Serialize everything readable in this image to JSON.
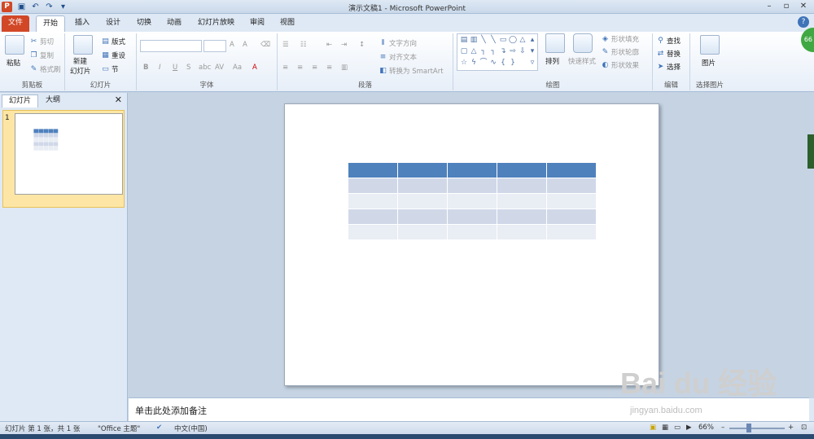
{
  "window": {
    "title": "演示文稿1 - Microsoft PowerPoint",
    "app_badge": "P"
  },
  "tabs": [
    "文件",
    "开始",
    "插入",
    "设计",
    "切换",
    "动画",
    "幻灯片放映",
    "审阅",
    "视图"
  ],
  "ribbon": {
    "clipboard": {
      "paste": "粘贴",
      "cut": "剪切",
      "copy": "复制",
      "format_painter": "格式刷",
      "label": "剪贴板"
    },
    "slides": {
      "new_slide": "新建",
      "new_slide2": "幻灯片",
      "layout": "版式",
      "reset": "重设",
      "section": "节",
      "label": "幻灯片"
    },
    "font": {
      "grow": "A",
      "shrink": "A",
      "bold": "B",
      "italic": "I",
      "underline": "U",
      "strike": "S",
      "shadow": "abc",
      "spacing": "AV",
      "case": "Aa",
      "label": "字体"
    },
    "paragraph": {
      "text_direction": "文字方向",
      "align_text": "对齐文本",
      "smartart": "转换为 SmartArt",
      "label": "段落"
    },
    "drawing": {
      "arrange": "排列",
      "quick_styles": "快速样式",
      "shape_fill": "形状填充",
      "shape_outline": "形状轮廓",
      "shape_effects": "形状效果",
      "label": "绘图"
    },
    "editing": {
      "find": "查找",
      "replace": "替换",
      "select": "选择",
      "label": "编辑"
    },
    "select_picture": {
      "picture": "图片",
      "label": "选择图片"
    }
  },
  "left_panel": {
    "tab_slides": "幻灯片",
    "tab_outline": "大纲",
    "close": "✕",
    "slide_number": "1"
  },
  "notes": {
    "placeholder": "单击此处添加备注"
  },
  "status": {
    "slide_info": "幻灯片 第 1 张，共 1 张",
    "theme": "\"Office 主题\"",
    "language": "中文(中国)",
    "zoom": "66%"
  },
  "badge": {
    "value": "66"
  },
  "watermark": {
    "logo": "Bai du 经验",
    "url": "jingyan.baidu.com"
  },
  "colors": {
    "accent": "#4f81bd",
    "file_tab": "#d24726",
    "table_light": "#e9edf4",
    "table_mid": "#d0d8e8"
  }
}
